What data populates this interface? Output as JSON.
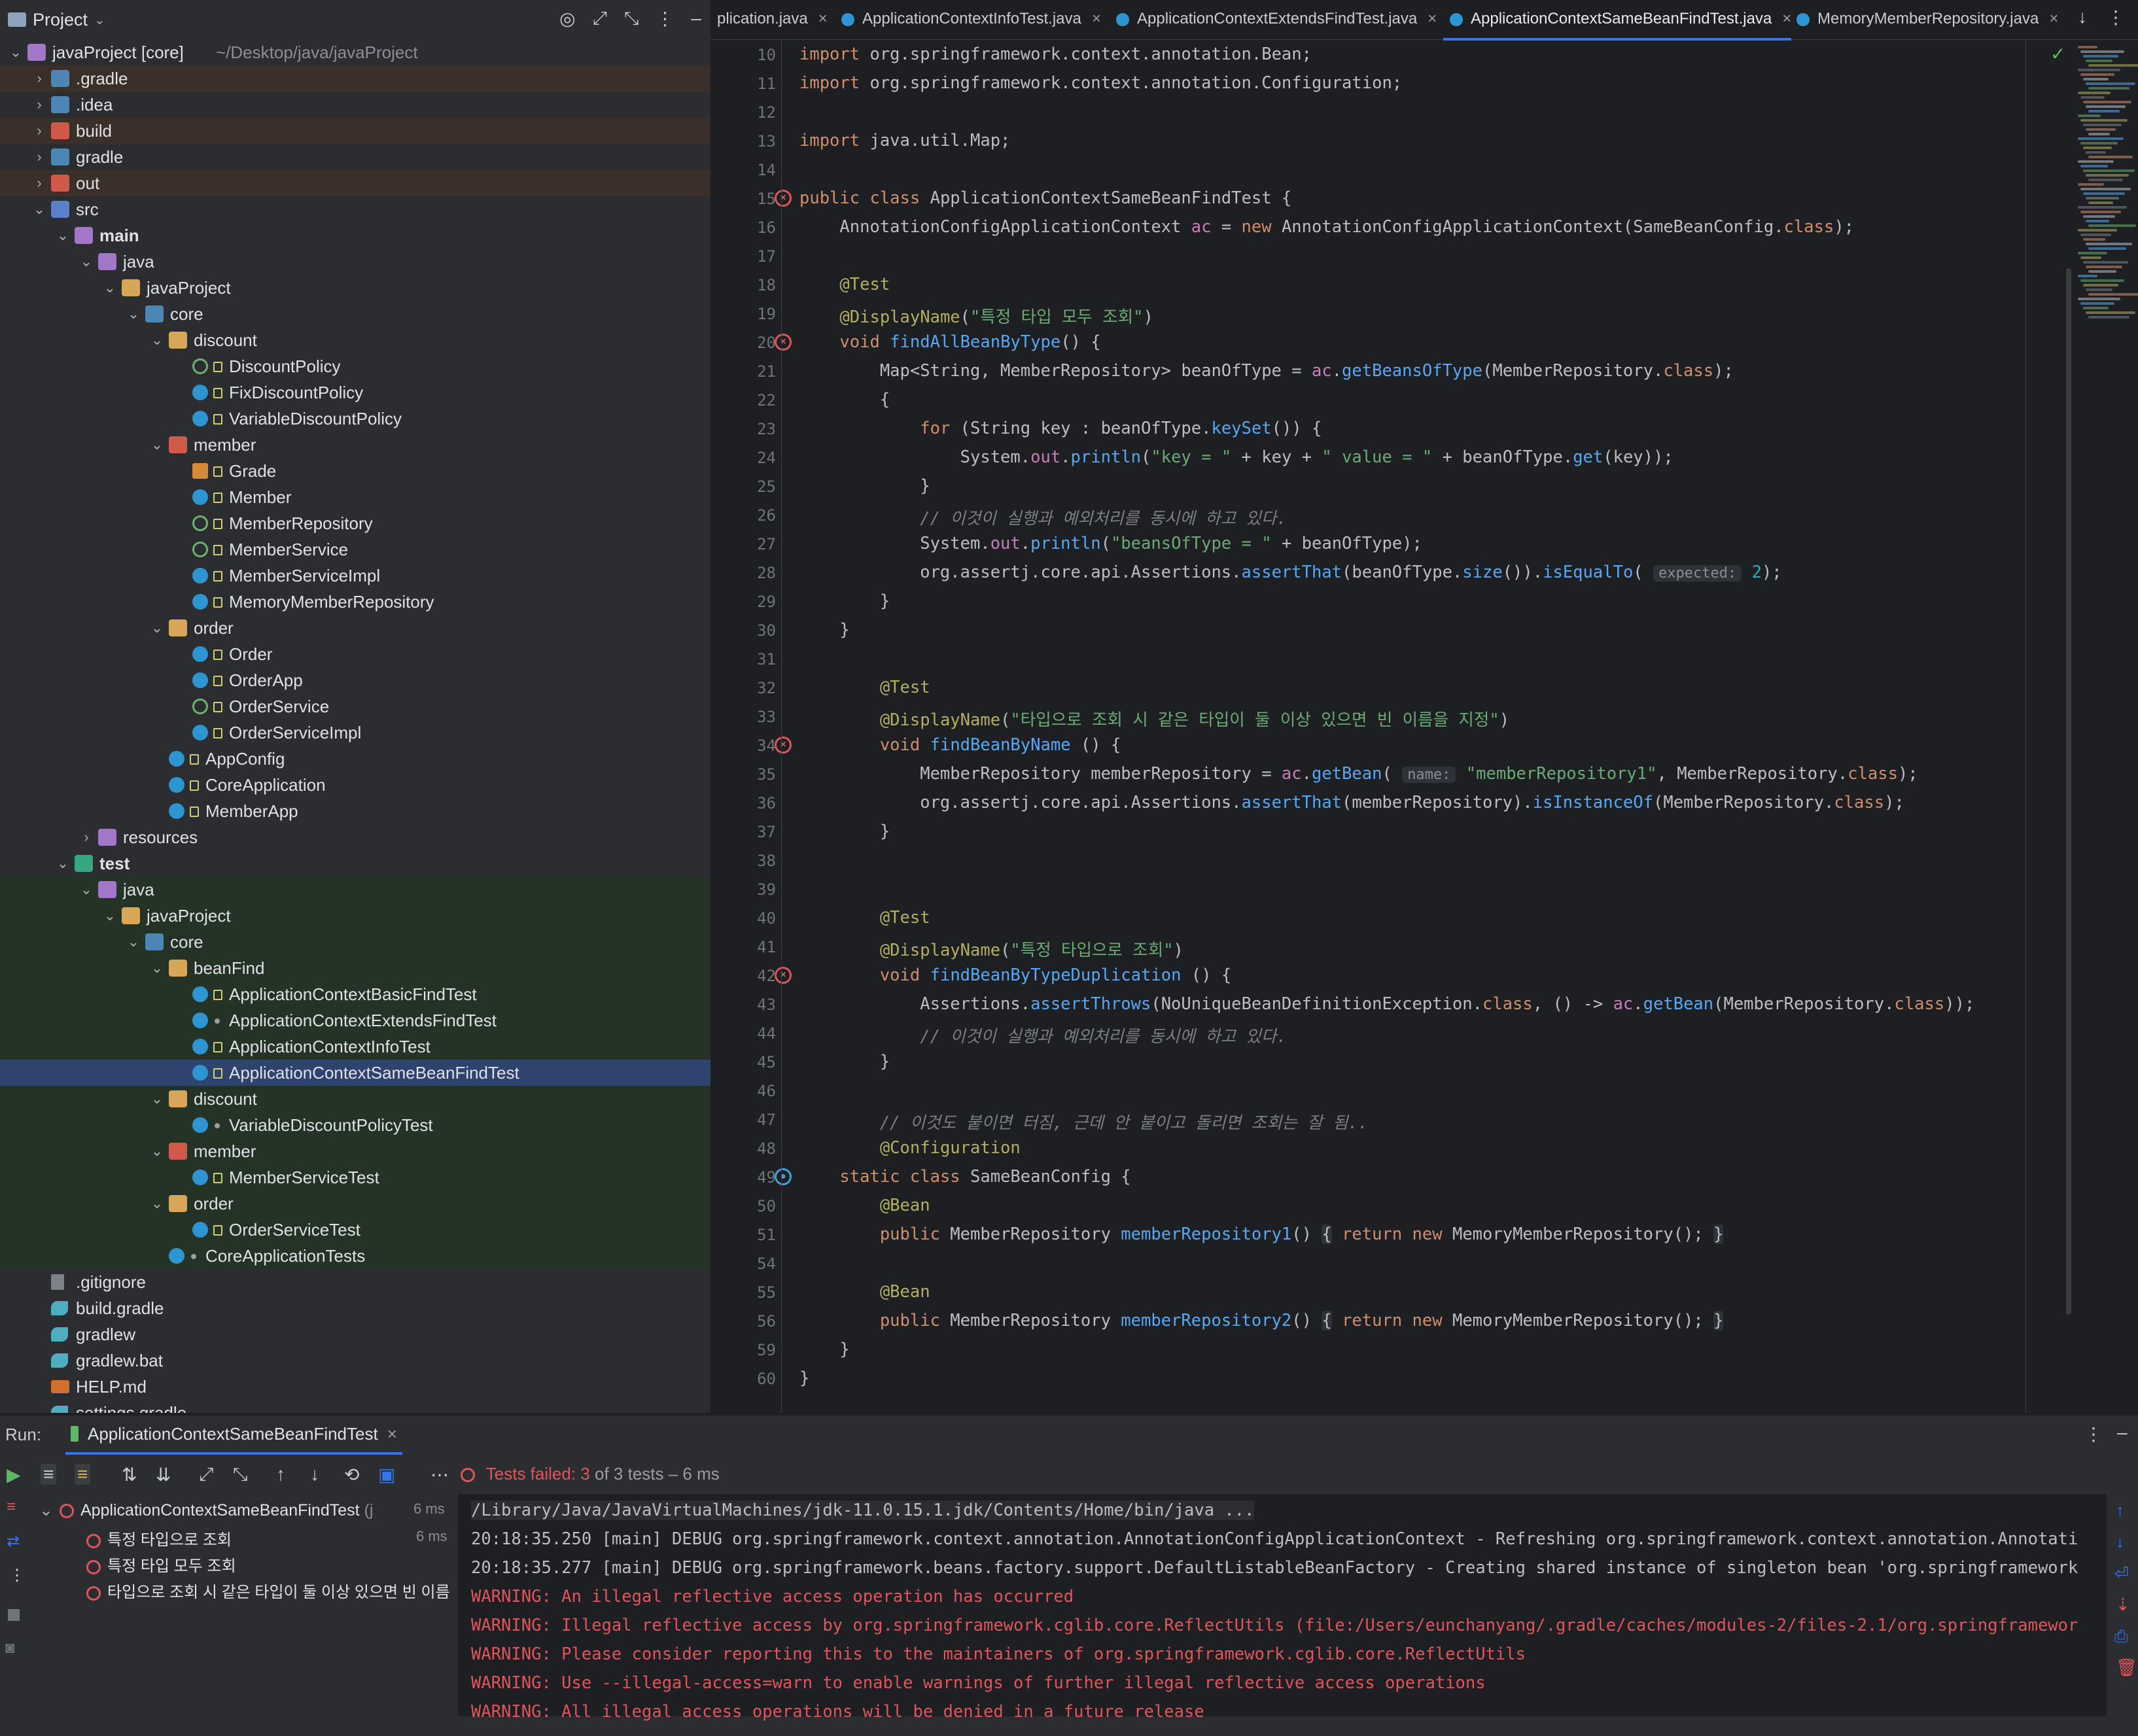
{
  "project_panel": {
    "title": "Project",
    "tree": [
      {
        "label": "javaProject [core]",
        "extra": "~/Desktop/java/javaProject",
        "icon": "module-icon",
        "kind": "folder-pkg",
        "depth": 0,
        "chev": "v",
        "hl": ""
      },
      {
        "label": ".gradle",
        "icon": "folder-icon",
        "kind": "folder-cfg",
        "depth": 1,
        "chev": ">",
        "hl": "orange"
      },
      {
        "label": ".idea",
        "icon": "folder-icon",
        "kind": "folder-cfg",
        "depth": 1,
        "chev": ">",
        "hl": ""
      },
      {
        "label": "build",
        "icon": "folder-icon",
        "kind": "folder-excl",
        "depth": 1,
        "chev": ">",
        "hl": "orange"
      },
      {
        "label": "gradle",
        "icon": "folder-icon",
        "kind": "folder-cfg",
        "depth": 1,
        "chev": ">",
        "hl": ""
      },
      {
        "label": "out",
        "icon": "folder-icon",
        "kind": "folder-excl",
        "depth": 1,
        "chev": ">",
        "hl": "orange"
      },
      {
        "label": "src",
        "icon": "folder-icon",
        "kind": "folder-src",
        "depth": 1,
        "chev": "v",
        "hl": ""
      },
      {
        "label": "main",
        "icon": "folder-icon",
        "kind": "folder-pkg",
        "depth": 2,
        "chev": "v",
        "hl": "",
        "bold": true
      },
      {
        "label": "java",
        "icon": "folder-icon",
        "kind": "folder-pkg",
        "depth": 3,
        "chev": "v",
        "hl": ""
      },
      {
        "label": "javaProject",
        "icon": "package-icon",
        "kind": "folder",
        "depth": 4,
        "chev": "v",
        "hl": ""
      },
      {
        "label": "core",
        "icon": "package-icon",
        "kind": "folder-cfg",
        "depth": 5,
        "chev": "v",
        "hl": ""
      },
      {
        "label": "discount",
        "icon": "package-icon",
        "kind": "folder",
        "depth": 6,
        "chev": "v",
        "hl": ""
      },
      {
        "label": "DiscountPolicy",
        "icon": "interface-icon",
        "kind": "iface",
        "depth": 7,
        "chev": "",
        "hl": "",
        "lock": true
      },
      {
        "label": "FixDiscountPolicy",
        "icon": "class-icon",
        "kind": "cls",
        "depth": 7,
        "chev": "",
        "hl": "",
        "lock": true
      },
      {
        "label": "VariableDiscountPolicy",
        "icon": "class-icon",
        "kind": "cls",
        "depth": 7,
        "chev": "",
        "hl": "",
        "lock": true
      },
      {
        "label": "member",
        "icon": "package-icon",
        "kind": "folder-excl",
        "depth": 6,
        "chev": "v",
        "hl": ""
      },
      {
        "label": "Grade",
        "icon": "enum-icon",
        "kind": "enum",
        "depth": 7,
        "chev": "",
        "hl": "",
        "lock": true
      },
      {
        "label": "Member",
        "icon": "class-icon",
        "kind": "cls",
        "depth": 7,
        "chev": "",
        "hl": "",
        "lock": true
      },
      {
        "label": "MemberRepository",
        "icon": "interface-icon",
        "kind": "iface",
        "depth": 7,
        "chev": "",
        "hl": "",
        "lock": true
      },
      {
        "label": "MemberService",
        "icon": "interface-icon",
        "kind": "iface",
        "depth": 7,
        "chev": "",
        "hl": "",
        "lock": true
      },
      {
        "label": "MemberServiceImpl",
        "icon": "class-icon",
        "kind": "cls",
        "depth": 7,
        "chev": "",
        "hl": "",
        "lock": true
      },
      {
        "label": "MemoryMemberRepository",
        "icon": "class-icon",
        "kind": "cls",
        "depth": 7,
        "chev": "",
        "hl": "",
        "lock": true
      },
      {
        "label": "order",
        "icon": "package-icon",
        "kind": "folder",
        "depth": 6,
        "chev": "v",
        "hl": ""
      },
      {
        "label": "Order",
        "icon": "class-icon",
        "kind": "cls",
        "depth": 7,
        "chev": "",
        "hl": "",
        "lock": true
      },
      {
        "label": "OrderApp",
        "icon": "class-icon",
        "kind": "cls",
        "depth": 7,
        "chev": "",
        "hl": "",
        "lock": true
      },
      {
        "label": "OrderService",
        "icon": "interface-icon",
        "kind": "iface",
        "depth": 7,
        "chev": "",
        "hl": "",
        "lock": true
      },
      {
        "label": "OrderServiceImpl",
        "icon": "class-icon",
        "kind": "cls",
        "depth": 7,
        "chev": "",
        "hl": "",
        "lock": true
      },
      {
        "label": "AppConfig",
        "icon": "class-icon",
        "kind": "cls",
        "depth": 6,
        "chev": "",
        "hl": "",
        "lock": true
      },
      {
        "label": "CoreApplication",
        "icon": "class-icon",
        "kind": "cls",
        "depth": 6,
        "chev": "",
        "hl": "",
        "lock": true
      },
      {
        "label": "MemberApp",
        "icon": "class-icon",
        "kind": "cls",
        "depth": 6,
        "chev": "",
        "hl": "",
        "lock": true
      },
      {
        "label": "resources",
        "icon": "folder-icon",
        "kind": "folder-pkg",
        "depth": 3,
        "chev": ">",
        "hl": ""
      },
      {
        "label": "test",
        "icon": "folder-icon",
        "kind": "folder-test",
        "depth": 2,
        "chev": "v",
        "hl": "",
        "bold": true
      },
      {
        "label": "java",
        "icon": "folder-icon",
        "kind": "folder-pkg",
        "depth": 3,
        "chev": "v",
        "hl": "green"
      },
      {
        "label": "javaProject",
        "icon": "package-icon",
        "kind": "folder",
        "depth": 4,
        "chev": "v",
        "hl": "green"
      },
      {
        "label": "core",
        "icon": "package-icon",
        "kind": "folder-cfg",
        "depth": 5,
        "chev": "v",
        "hl": "green"
      },
      {
        "label": "beanFind",
        "icon": "package-icon",
        "kind": "folder",
        "depth": 6,
        "chev": "v",
        "hl": "green"
      },
      {
        "label": "ApplicationContextBasicFindTest",
        "icon": "class-icon",
        "kind": "cls",
        "depth": 7,
        "chev": "",
        "hl": "green",
        "lock": true
      },
      {
        "label": "ApplicationContextExtendsFindTest",
        "icon": "class-icon",
        "kind": "cls",
        "depth": 7,
        "chev": "",
        "hl": "green",
        "dot": true
      },
      {
        "label": "ApplicationContextInfoTest",
        "icon": "class-icon",
        "kind": "cls",
        "depth": 7,
        "chev": "",
        "hl": "green",
        "lock": true
      },
      {
        "label": "ApplicationContextSameBeanFindTest",
        "icon": "class-icon",
        "kind": "cls",
        "depth": 7,
        "chev": "",
        "hl": "select",
        "lock": true
      },
      {
        "label": "discount",
        "icon": "package-icon",
        "kind": "folder",
        "depth": 6,
        "chev": "v",
        "hl": "green"
      },
      {
        "label": "VariableDiscountPolicyTest",
        "icon": "class-icon",
        "kind": "cls",
        "depth": 7,
        "chev": "",
        "hl": "green",
        "dot": true
      },
      {
        "label": "member",
        "icon": "package-icon",
        "kind": "folder-excl",
        "depth": 6,
        "chev": "v",
        "hl": "green"
      },
      {
        "label": "MemberServiceTest",
        "icon": "class-icon",
        "kind": "cls",
        "depth": 7,
        "chev": "",
        "hl": "green",
        "lock": true
      },
      {
        "label": "order",
        "icon": "package-icon",
        "kind": "folder",
        "depth": 6,
        "chev": "v",
        "hl": "green"
      },
      {
        "label": "OrderServiceTest",
        "icon": "class-icon",
        "kind": "cls",
        "depth": 7,
        "chev": "",
        "hl": "green",
        "lock": true
      },
      {
        "label": "CoreApplicationTests",
        "icon": "class-icon",
        "kind": "cls",
        "depth": 6,
        "chev": "",
        "hl": "green",
        "dot": true
      },
      {
        "label": ".gitignore",
        "icon": "git-icon",
        "kind": "file",
        "depth": 1,
        "chev": "",
        "hl": ""
      },
      {
        "label": "build.gradle",
        "icon": "gradle-icon",
        "kind": "gradle-file",
        "depth": 1,
        "chev": "",
        "hl": ""
      },
      {
        "label": "gradlew",
        "icon": "gradle-icon",
        "kind": "gradle-file",
        "depth": 1,
        "chev": "",
        "hl": ""
      },
      {
        "label": "gradlew.bat",
        "icon": "gradle-icon",
        "kind": "gradle-file",
        "depth": 1,
        "chev": "",
        "hl": ""
      },
      {
        "label": "HELP.md",
        "icon": "markdown-icon",
        "kind": "md",
        "depth": 1,
        "chev": "",
        "hl": ""
      },
      {
        "label": "settings.gradle",
        "icon": "gradle-icon",
        "kind": "gradle-file",
        "depth": 1,
        "chev": "",
        "hl": ""
      }
    ]
  },
  "editor_tabs": [
    {
      "label": "plication.java",
      "active": false,
      "icon": false
    },
    {
      "label": "ApplicationContextInfoTest.java",
      "active": false,
      "icon": true
    },
    {
      "label": "ApplicationContextExtendsFindTest.java",
      "active": false,
      "icon": true
    },
    {
      "label": "ApplicationContextSameBeanFindTest.java",
      "active": true,
      "icon": true
    },
    {
      "label": "MemoryMemberRepository.java",
      "active": false,
      "icon": true
    }
  ],
  "code_lines": [
    {
      "no": "10",
      "html": "<span class=\"kw\">import</span> org.springframework.context.annotation.Bean;"
    },
    {
      "no": "11",
      "html": "<span class=\"kw\">import</span> org.springframework.context.annotation.Configuration;"
    },
    {
      "no": "12",
      "html": ""
    },
    {
      "no": "13",
      "html": "<span class=\"kw\">import</span> java.util.Map;"
    },
    {
      "no": "14",
      "html": ""
    },
    {
      "no": "15",
      "html": "<span class=\"kw\">public class</span> ApplicationContextSameBeanFindTest {",
      "err": true
    },
    {
      "no": "16",
      "html": "    AnnotationConfigApplicationContext <span class=\"fld\">ac</span> = <span class=\"kw\">new</span> AnnotationConfigApplicationContext(SameBeanConfig.<span class=\"kw\">class</span>);"
    },
    {
      "no": "17",
      "html": ""
    },
    {
      "no": "18",
      "html": "    <span class=\"ann\">@Test</span>"
    },
    {
      "no": "19",
      "html": "    <span class=\"ann\">@DisplayName</span>(<span class=\"str\">\"특정 타입 모두 조회\"</span>)"
    },
    {
      "no": "20",
      "html": "    <span class=\"kw\">void</span> <span class=\"fn\">findAllBeanByType</span>() {",
      "err": true
    },
    {
      "no": "21",
      "html": "        Map&lt;String, MemberRepository&gt; beanOfType = <span class=\"fld\">ac</span>.<span class=\"fn\">getBeansOfType</span>(MemberRepository.<span class=\"kw\">class</span>);"
    },
    {
      "no": "22",
      "html": "        {"
    },
    {
      "no": "23",
      "html": "            <span class=\"kw\">for</span> (String key : beanOfType.<span class=\"fn\">keySet</span>()) {"
    },
    {
      "no": "24",
      "html": "                System.<span class=\"fld\">out</span>.<span class=\"fn\">println</span>(<span class=\"str\">\"key = \"</span> + key + <span class=\"str\">\" value = \"</span> + beanOfType.<span class=\"fn\">get</span>(key));"
    },
    {
      "no": "25",
      "html": "            }"
    },
    {
      "no": "26",
      "html": "            <span class=\"cmt\">// 이것이 실행과 예외처리를 동시에 하고 있다.</span>"
    },
    {
      "no": "27",
      "html": "            System.<span class=\"fld\">out</span>.<span class=\"fn\">println</span>(<span class=\"str\">\"beansOfType = \"</span> + beanOfType);"
    },
    {
      "no": "28",
      "html": "            org.assertj.core.api.Assertions.<span class=\"fn\">assertThat</span>(beanOfType.<span class=\"fn\">size</span>()).<span class=\"fn\">isEqualTo</span>( <span class=\"hint\">expected:</span> <span class=\"num\">2</span>);"
    },
    {
      "no": "29",
      "html": "        }"
    },
    {
      "no": "30",
      "html": "    }"
    },
    {
      "no": "31",
      "html": ""
    },
    {
      "no": "32",
      "html": "        <span class=\"ann\">@Test</span>"
    },
    {
      "no": "33",
      "html": "        <span class=\"ann\">@DisplayName</span>(<span class=\"str\">\"타입으로 조회 시 같은 타입이 둘 이상 있으면 빈 이름을 지정\"</span>)"
    },
    {
      "no": "34",
      "html": "        <span class=\"kw\">void</span> <span class=\"fn\">findBeanByName</span> () {",
      "err": true
    },
    {
      "no": "35",
      "html": "            MemberRepository memberRepository = <span class=\"fld\">ac</span>.<span class=\"fn\">getBean</span>( <span class=\"hint\">name:</span> <span class=\"str\">\"memberRepository1\"</span>, MemberRepository.<span class=\"kw\">class</span>);"
    },
    {
      "no": "36",
      "html": "            org.assertj.core.api.Assertions.<span class=\"fn\">assertThat</span>(memberRepository).<span class=\"fn\">isInstanceOf</span>(MemberRepository.<span class=\"kw\">class</span>);"
    },
    {
      "no": "37",
      "html": "        }"
    },
    {
      "no": "38",
      "html": ""
    },
    {
      "no": "39",
      "html": ""
    },
    {
      "no": "40",
      "html": "        <span class=\"ann\">@Test</span>"
    },
    {
      "no": "41",
      "html": "        <span class=\"ann\">@DisplayName</span>(<span class=\"str\">\"특정 타입으로 조회\"</span>)"
    },
    {
      "no": "42",
      "html": "        <span class=\"kw\">void</span> <span class=\"fn\">findBeanByTypeDuplication</span> () {",
      "err": true
    },
    {
      "no": "43",
      "html": "            Assertions.<span class=\"fn\">assertThrows</span>(NoUniqueBeanDefinitionException.<span class=\"kw\">class</span>, () -&gt; <span class=\"fld\">ac</span>.<span class=\"fn\">getBean</span>(MemberRepository.<span class=\"kw\">class</span>));"
    },
    {
      "no": "44",
      "html": "            <span class=\"cmt\">// 이것이 실행과 예외처리를 동시에 하고 있다.</span>"
    },
    {
      "no": "45",
      "html": "        }"
    },
    {
      "no": "46",
      "html": ""
    },
    {
      "no": "47",
      "html": "        <span class=\"cmt\">// 이것도 붙이면 터짐, 근데 안 붙이고 돌리면 조회는 잘 됨..</span>"
    },
    {
      "no": "48",
      "html": "        <span class=\"ann\">@Configuration</span>"
    },
    {
      "no": "49",
      "html": "    <span class=\"kw\">static class</span> SameBeanConfig {",
      "bean": true
    },
    {
      "no": "50",
      "html": "        <span class=\"ann\">@Bean</span>"
    },
    {
      "no": "51",
      "html": "        <span class=\"kw\">public</span> MemberRepository <span class=\"fn\">memberRepository1</span>() <span class=\"fold\">{</span> <span class=\"kw\">return new</span> MemoryMemberRepository(); <span class=\"fold\">}</span>"
    },
    {
      "no": "54",
      "html": ""
    },
    {
      "no": "55",
      "html": "        <span class=\"ann\">@Bean</span>"
    },
    {
      "no": "56",
      "html": "        <span class=\"kw\">public</span> MemberRepository <span class=\"fn\">memberRepository2</span>() <span class=\"fold\">{</span> <span class=\"kw\">return new</span> MemoryMemberRepository(); <span class=\"fold\">}</span>"
    },
    {
      "no": "59",
      "html": "    }"
    },
    {
      "no": "60",
      "html": "}"
    }
  ],
  "run_panel": {
    "run_label": "Run:",
    "tab_label": "ApplicationContextSameBeanFindTest",
    "status_text": "Tests failed:",
    "status_count": "3",
    "status_rest": "of 3 tests – 6 ms",
    "test_root": {
      "label": "ApplicationContextSameBeanFindTest",
      "suffix": "(j",
      "time": "6 ms"
    },
    "tests": [
      {
        "label": "특정 타입으로 조회",
        "time": "6 ms"
      },
      {
        "label": "특정 타입 모두 조회",
        "time": ""
      },
      {
        "label": "타입으로 조회 시 같은 타입이 둘 이상 있으면 빈 이름",
        "time": ""
      }
    ],
    "console": [
      {
        "text": "/Library/Java/JavaVirtualMachines/jdk-11.0.15.1.jdk/Contents/Home/bin/java ...",
        "warn": false
      },
      {
        "text": "20:18:35.250 [main] DEBUG org.springframework.context.annotation.AnnotationConfigApplicationContext - Refreshing org.springframework.context.annotation.Annotati",
        "warn": false
      },
      {
        "text": "20:18:35.277 [main] DEBUG org.springframework.beans.factory.support.DefaultListableBeanFactory - Creating shared instance of singleton bean 'org.springframework",
        "warn": false
      },
      {
        "text": "WARNING: An illegal reflective access operation has occurred",
        "warn": true
      },
      {
        "text": "WARNING: Illegal reflective access by org.springframework.cglib.core.ReflectUtils (file:/Users/eunchanyang/.gradle/caches/modules-2/files-2.1/org.springframewor",
        "warn": true
      },
      {
        "text": "WARNING: Please consider reporting this to the maintainers of org.springframework.cglib.core.ReflectUtils",
        "warn": true
      },
      {
        "text": "WARNING: Use --illegal-access=warn to enable warnings of further illegal reflective access operations",
        "warn": true
      },
      {
        "text": "WARNING: All illegal access operations will be denied in a future release",
        "warn": true
      }
    ]
  },
  "colors": {
    "accent": "#3574f0",
    "error": "#e0555c",
    "success": "#5fb865"
  }
}
